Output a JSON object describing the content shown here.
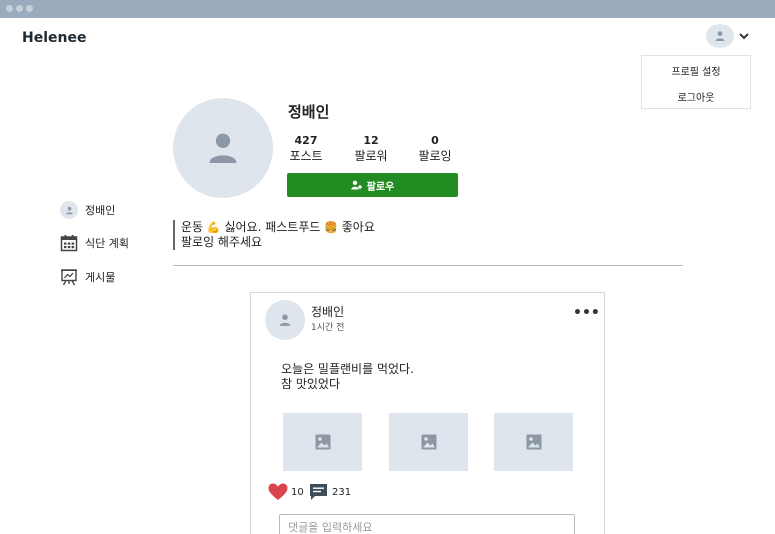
{
  "app": {
    "brand": "Helenee"
  },
  "header": {
    "menu": {
      "items": [
        "프로필 설정",
        "로그아웃"
      ]
    }
  },
  "profile": {
    "name": "정배인",
    "stats": [
      {
        "value": "427",
        "label": "포스트"
      },
      {
        "value": "12",
        "label": "팔로워"
      },
      {
        "value": "0",
        "label": "팔로잉"
      }
    ],
    "follow_label": "팔로우",
    "bio": {
      "line1_a": "운동",
      "line1_b": "싫어요. 패스트푸드",
      "line1_c": "좋아요",
      "line2": "팔로잉 해주세요"
    }
  },
  "sidebar": {
    "items": [
      {
        "label": "정배인",
        "icon": "avatar-icon"
      },
      {
        "label": "식단 계획",
        "icon": "calendar-icon"
      },
      {
        "label": "게시물",
        "icon": "board-icon"
      }
    ]
  },
  "post": {
    "author": "정배인",
    "time": "1시간 전",
    "more": "•••",
    "content": "오늘은 밀플랜비를 먹었다.\n참 맛있었다",
    "likes": "10",
    "comments": "231",
    "comment_placeholder": "댓글을 입력하세요"
  },
  "colors": {
    "accent": "#228b22",
    "avatar_bg": "#dfe5ec",
    "titlebar": "#9aabbd",
    "heart": "#d9454c"
  }
}
